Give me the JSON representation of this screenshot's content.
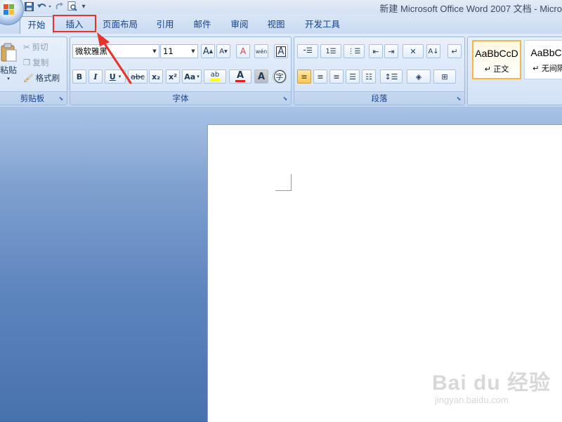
{
  "window": {
    "title": "新建 Microsoft Office Word 2007 文档 - Micro"
  },
  "qat": {
    "save_icon": "save-icon",
    "undo_icon": "undo-icon",
    "redo_icon": "redo-icon",
    "print_preview_icon": "print-preview-icon",
    "customize": "▾"
  },
  "tabs": [
    {
      "label": "开始"
    },
    {
      "label": "插入"
    },
    {
      "label": "页面布局"
    },
    {
      "label": "引用"
    },
    {
      "label": "邮件"
    },
    {
      "label": "审阅"
    },
    {
      "label": "视图"
    },
    {
      "label": "开发工具"
    }
  ],
  "clipboard": {
    "group_label": "剪贴板",
    "paste": "粘贴",
    "cut": "剪切",
    "copy": "复制",
    "format_painter": "格式刷"
  },
  "font": {
    "group_label": "字体",
    "font_name": "微软雅黑",
    "font_size": "11",
    "bold": "B",
    "italic": "I",
    "underline": "U",
    "strike": "abc",
    "subscript": "x₂",
    "superscript": "x²",
    "change_case": "Aa",
    "grow": "A",
    "shrink": "A",
    "clear_format": "A",
    "phonetic": "wén",
    "border_char": "A",
    "highlight": "ab",
    "font_color": "A",
    "shade_char": "A",
    "enclose_char": "字",
    "font_color_value": "#e0201a",
    "highlight_color_value": "#ffff00"
  },
  "paragraph": {
    "group_label": "段落"
  },
  "styles": {
    "items": [
      {
        "sample": "AaBbCcD",
        "name": "↵ 正文"
      },
      {
        "sample": "AaBbCc",
        "name": "↵ 无间隔"
      }
    ]
  },
  "watermark": {
    "main": "Bai du 经验",
    "sub": "jingyan.baidu.com"
  },
  "colors": {
    "annotation": "#e8332a"
  }
}
